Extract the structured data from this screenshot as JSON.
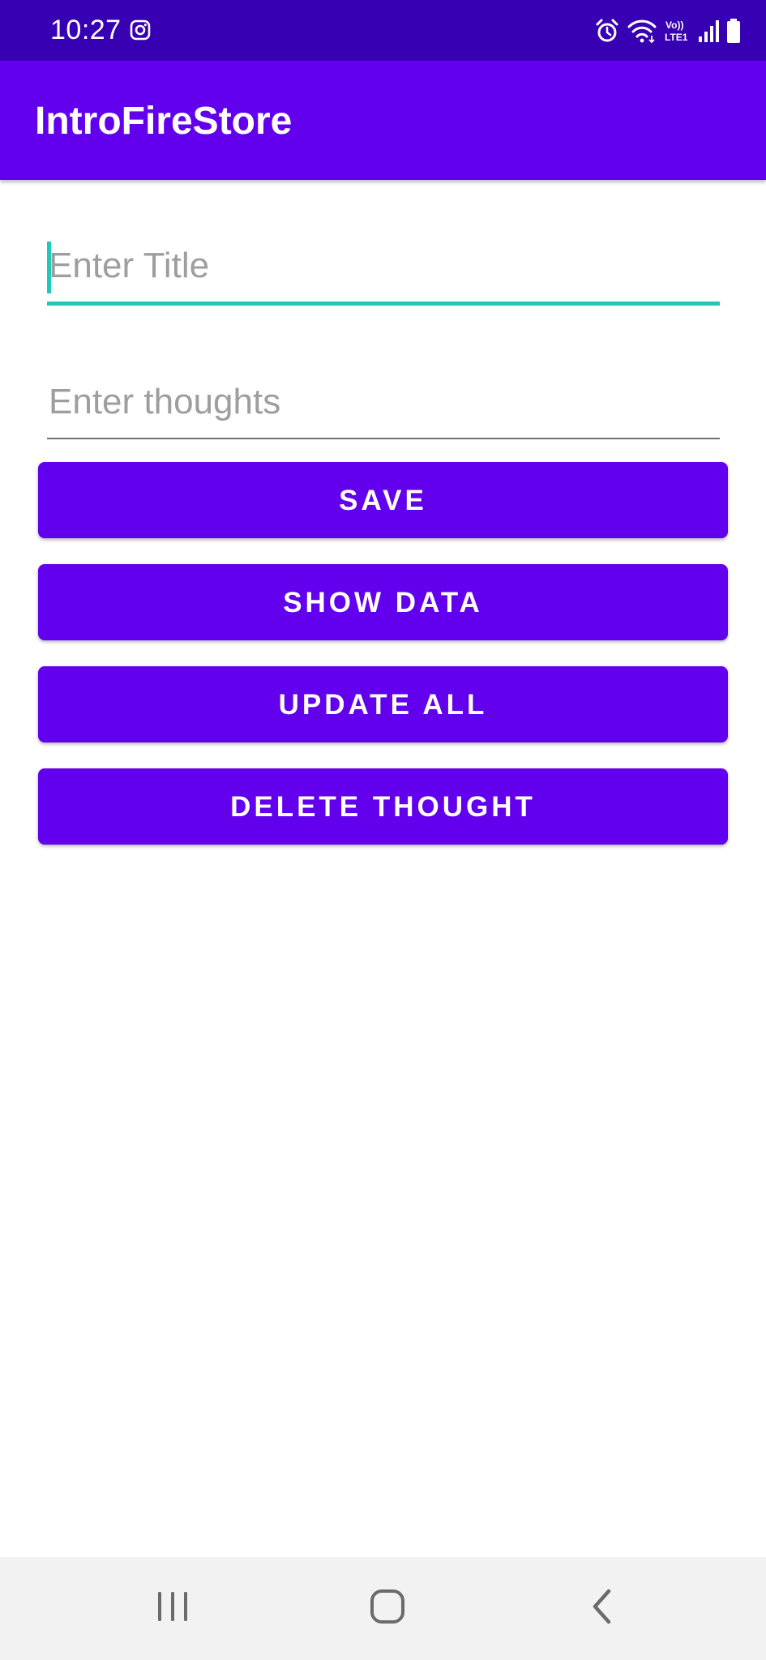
{
  "status_bar": {
    "time": "10:27",
    "left_icons": [
      "instagram-icon"
    ],
    "right_icons": [
      "alarm-icon",
      "wifi-icon",
      "volte-lte-icon",
      "signal-icon",
      "battery-icon"
    ]
  },
  "app_bar": {
    "title": "IntroFireStore"
  },
  "form": {
    "title_placeholder": "Enter Title",
    "title_value": "",
    "thoughts_placeholder": "Enter thoughts",
    "thoughts_value": ""
  },
  "buttons": {
    "save": "SAVE",
    "show_data": "SHOW DATA",
    "update_all": "UPDATE ALL",
    "delete_thought": "DELETE THOUGHT"
  },
  "nav_bar": {
    "icons": [
      "recents-icon",
      "home-icon",
      "back-icon"
    ]
  },
  "colors": {
    "status_bar": "#3700b3",
    "primary": "#6200ee",
    "accent": "#1dc9b7"
  }
}
